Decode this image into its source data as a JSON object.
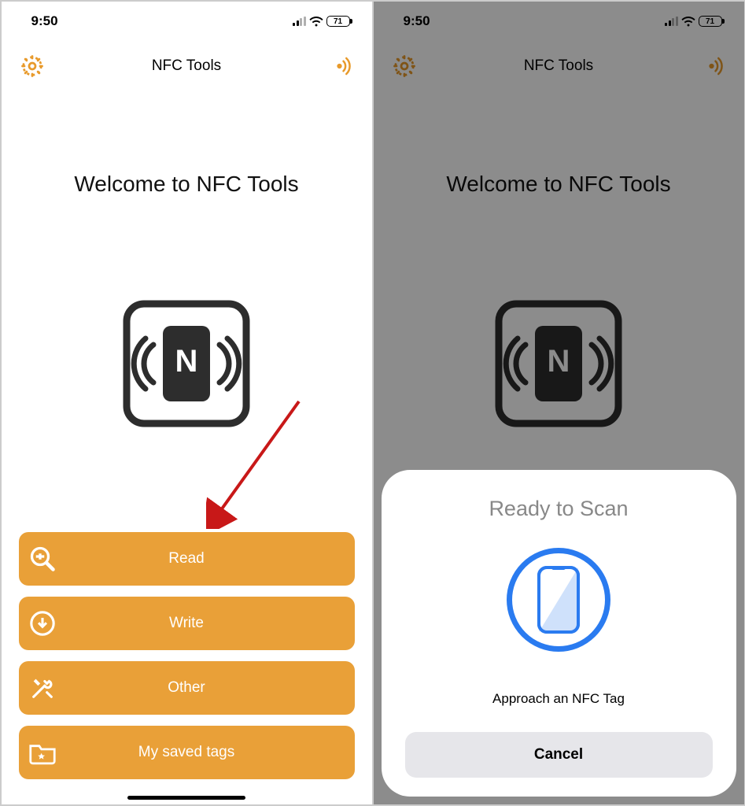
{
  "status": {
    "time": "9:50",
    "battery": "71"
  },
  "header": {
    "title": "NFC Tools"
  },
  "welcome": "Welcome to NFC Tools",
  "menu": {
    "read": {
      "label": "Read"
    },
    "write": {
      "label": "Write"
    },
    "other": {
      "label": "Other"
    },
    "saved": {
      "label": "My saved tags"
    }
  },
  "sheet": {
    "title": "Ready to Scan",
    "message": "Approach an NFC Tag",
    "cancel": "Cancel"
  },
  "colors": {
    "accent": "#e89a2b",
    "button": "#e9a038",
    "scanRing": "#2a7bf0"
  }
}
